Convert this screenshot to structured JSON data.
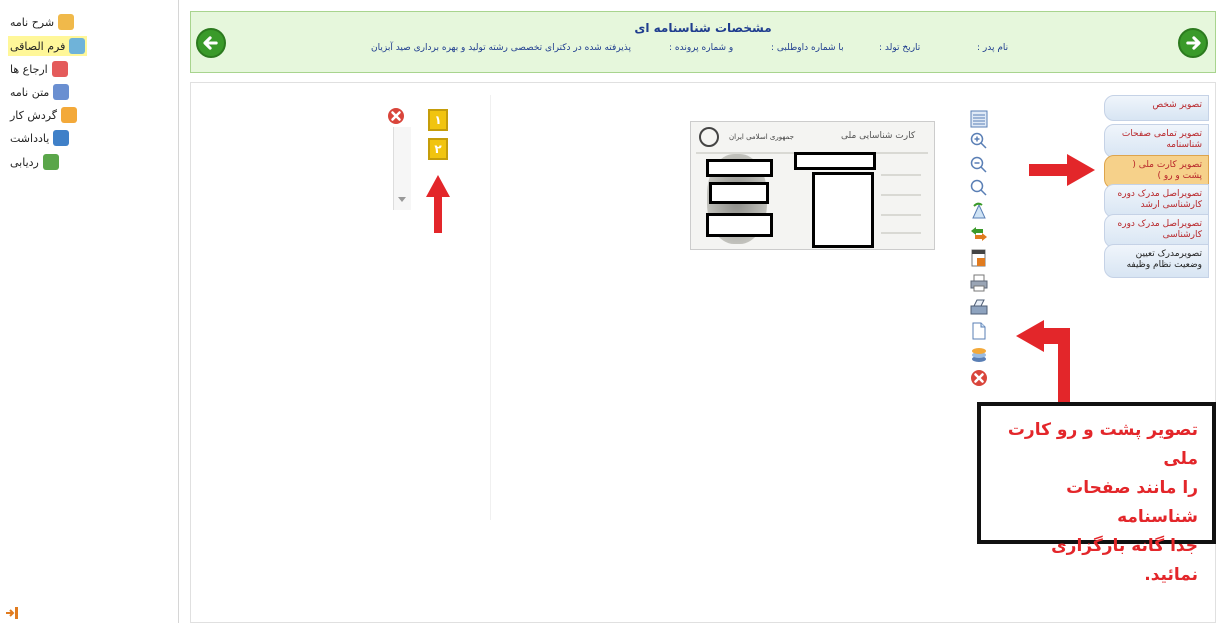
{
  "sidebar": {
    "items": [
      {
        "label": "شرح نامه",
        "icon": "envelope-icon",
        "color": "#f0b94a",
        "active": false
      },
      {
        "label": "فرم الصاقی",
        "icon": "form-icon",
        "color": "#6fb3d9",
        "active": true
      },
      {
        "label": "ارجاع ها",
        "icon": "referral-icon",
        "color": "#e45b5b",
        "active": false
      },
      {
        "label": "متن نامه",
        "icon": "letter-text-icon",
        "color": "#6a8fd1",
        "active": false
      },
      {
        "label": "گردش کار",
        "icon": "workflow-icon",
        "color": "#f3a93a",
        "active": false
      },
      {
        "label": "یادداشت",
        "icon": "note-icon",
        "color": "#3f80c8",
        "active": false
      },
      {
        "label": "ردیابی",
        "icon": "tracking-icon",
        "color": "#5aa64a",
        "active": false
      }
    ]
  },
  "header": {
    "title": "مشخصات شناسنامه ای",
    "fields": {
      "father": "نام پدر :",
      "birth": "تاریخ تولد :",
      "applicant": "با شماره داوطلبی :",
      "file": "و شماره پرونده :",
      "accepted": "پذیرفته شده در دکترای تخصصی رشته تولید و بهره برداری صید آبزیان"
    }
  },
  "tabs": [
    {
      "label": "تصویر شخص"
    },
    {
      "label": "تصویر تمامی صفحات شناسنامه"
    },
    {
      "label": "تصویر کارت ملی ( پشت و رو )"
    },
    {
      "label": "تصویراصل مدرک دوره کارشناسی ارشد"
    },
    {
      "label": "تصویراصل مدرک دوره کارشناسی"
    },
    {
      "label": "تصویرمدرک تعیین وضعیت نظام وظیفه"
    }
  ],
  "pages": [
    "۱",
    "۲"
  ],
  "card": {
    "heading": "کارت شناسایی ملی",
    "issuer": "جمهوری اسلامی ایران"
  },
  "callout": {
    "line1": "تصویر پشت و رو کارت ملی",
    "line2": "را  مانند صفحات شناسنامه",
    "line3": "جدا گانه بارگزاری نمائید."
  },
  "colors": {
    "accent_green": "#3a9a2a",
    "header_bg": "#e6f7dc",
    "arrow_red": "#e3262a",
    "selected_tab": "#f6d18a"
  }
}
